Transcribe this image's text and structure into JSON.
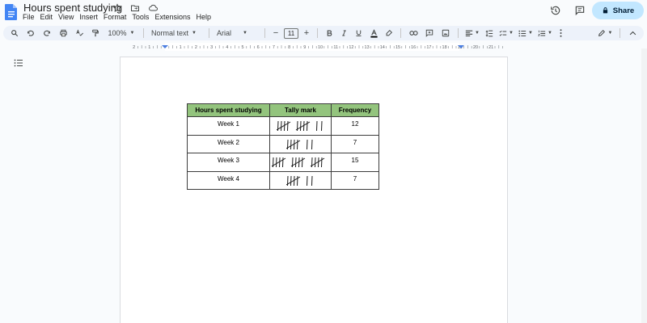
{
  "document": {
    "title": "Hours spent studying"
  },
  "menu": [
    "File",
    "Edit",
    "View",
    "Insert",
    "Format",
    "Tools",
    "Extensions",
    "Help"
  ],
  "header": {
    "share_label": "Share"
  },
  "toolbar": {
    "zoom": "100%",
    "style": "Normal text",
    "font": "Arial",
    "font_size": "11",
    "decrease_symbol": "−",
    "increase_symbol": "+"
  },
  "table": {
    "headers": [
      "Hours spent studying",
      "Tally mark",
      "Frequency"
    ],
    "header_color": "#93c47d",
    "rows": [
      {
        "label": "Week 1",
        "frequency": "12",
        "tally": 12
      },
      {
        "label": "Week 2",
        "frequency": "7",
        "tally": 7
      },
      {
        "label": "Week 3",
        "frequency": "15",
        "tally": 15
      },
      {
        "label": "Week 4",
        "frequency": "7",
        "tally": 7
      }
    ]
  },
  "colors": {
    "accent": "#c2e7ff",
    "toolbar_bg": "#edf2fa",
    "doc_blue": "#4285f4"
  }
}
